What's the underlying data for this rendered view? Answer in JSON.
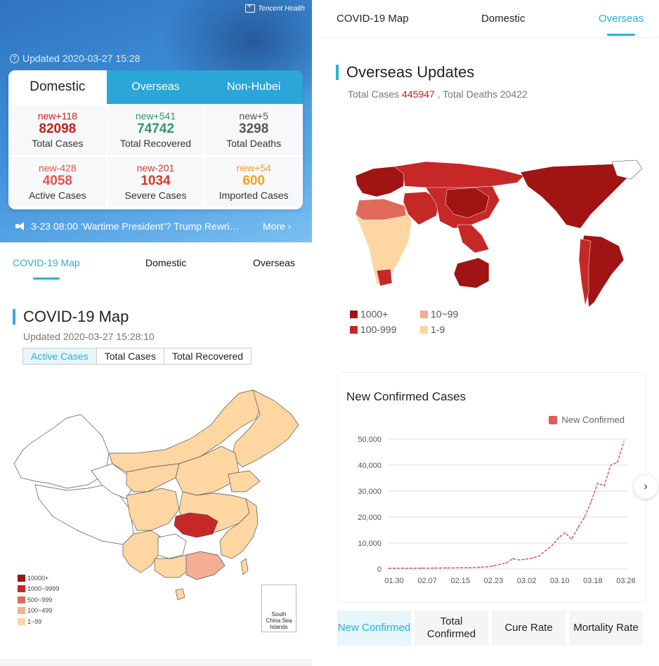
{
  "left": {
    "brand": "Tencent Health",
    "updated": "Updated 2020-03-27 15:28",
    "stat_tabs": [
      "Domestic",
      "Overseas",
      "Non-Hubei"
    ],
    "stats": [
      {
        "delta": "new+118",
        "value": "82098",
        "label": "Total Cases",
        "color": "#c21f1f"
      },
      {
        "delta": "new+541",
        "value": "74742",
        "label": "Total Recovered",
        "color": "#2f9a6b"
      },
      {
        "delta": "new+5",
        "value": "3298",
        "label": "Total Deaths",
        "color": "#555555"
      },
      {
        "delta": "new-428",
        "value": "4058",
        "label": "Active Cases",
        "color": "#e0584a"
      },
      {
        "delta": "new-201",
        "value": "1034",
        "label": "Severe Cases",
        "color": "#d7392b"
      },
      {
        "delta": "new+54",
        "value": "600",
        "label": "Imported Cases",
        "color": "#f4a21b"
      }
    ],
    "ticker_text": "3-23 08:00 ‘Wartime President’? Trump Rewri…",
    "ticker_more": "More",
    "nav_tabs": [
      "COVID-19 Map",
      "Domestic",
      "Overseas"
    ],
    "map_title": "COVID-19 Map",
    "map_updated": "Updated 2020-03-27 15:28:10",
    "map_modes": [
      "Active Cases",
      "Total Cases",
      "Total Recovered"
    ],
    "map_legend": [
      {
        "label": "10000+",
        "color": "#a01414"
      },
      {
        "label": "1000~9999",
        "color": "#c62828"
      },
      {
        "label": "500~999",
        "color": "#e06b5b"
      },
      {
        "label": "100~499",
        "color": "#f5ad93"
      },
      {
        "label": "1~99",
        "color": "#fdd6a2"
      }
    ],
    "inset_label": "South China Sea Islands"
  },
  "right": {
    "nav_tabs": [
      "COVID-19 Map",
      "Domestic",
      "Overseas"
    ],
    "title": "Overseas Updates",
    "summary_prefix": "Total Cases ",
    "summary_cases": "445947",
    "summary_suffix": " , Total Deaths 20422",
    "map_legend": [
      {
        "label": "1000+",
        "color": "#a01414"
      },
      {
        "label": "10~99",
        "color": "#f5ad93"
      },
      {
        "label": "100-999",
        "color": "#c62828"
      },
      {
        "label": "1-9",
        "color": "#fdd6a2"
      }
    ],
    "buttons": [
      "New Confirmed",
      "Total Confirmed",
      "Cure Rate",
      "Mortality Rate"
    ]
  },
  "chart_data": {
    "type": "line",
    "title": "New Confirmed Cases",
    "series": [
      {
        "name": "New Confirmed",
        "color": "#e05b5b",
        "values": [
          300,
          300,
          300,
          300,
          350,
          350,
          350,
          400,
          400,
          450,
          450,
          500,
          500,
          600,
          700,
          800,
          1200,
          1800,
          2300,
          4000,
          3500,
          3800,
          4200,
          5000,
          7000,
          9000,
          12000,
          14000,
          11500,
          16000,
          20000,
          26000,
          33000,
          32000,
          40000,
          41000,
          49000
        ]
      }
    ],
    "x": [
      "01.30",
      "01.31",
      "02.01",
      "02.03",
      "02.05",
      "02.07",
      "02.09",
      "02.11",
      "02.13",
      "02.15",
      "02.17",
      "02.19",
      "02.21",
      "02.23",
      "02.25",
      "02.27",
      "02.29",
      "03.02",
      "03.04",
      "03.06",
      "03.08",
      "03.10",
      "03.11",
      "03.12",
      "03.13",
      "03.14",
      "03.15",
      "03.16",
      "03.17",
      "03.18",
      "03.19",
      "03.20",
      "03.21",
      "03.22",
      "03.23",
      "03.24",
      "03.26"
    ],
    "x_ticks": [
      "01.30",
      "02.07",
      "02.15",
      "02.23",
      "03.02",
      "03.10",
      "03.18",
      "03.26"
    ],
    "y_ticks": [
      "50,000",
      "40,000",
      "30,000",
      "20,000",
      "10,000",
      "0"
    ],
    "ylim": [
      0,
      50000
    ]
  }
}
